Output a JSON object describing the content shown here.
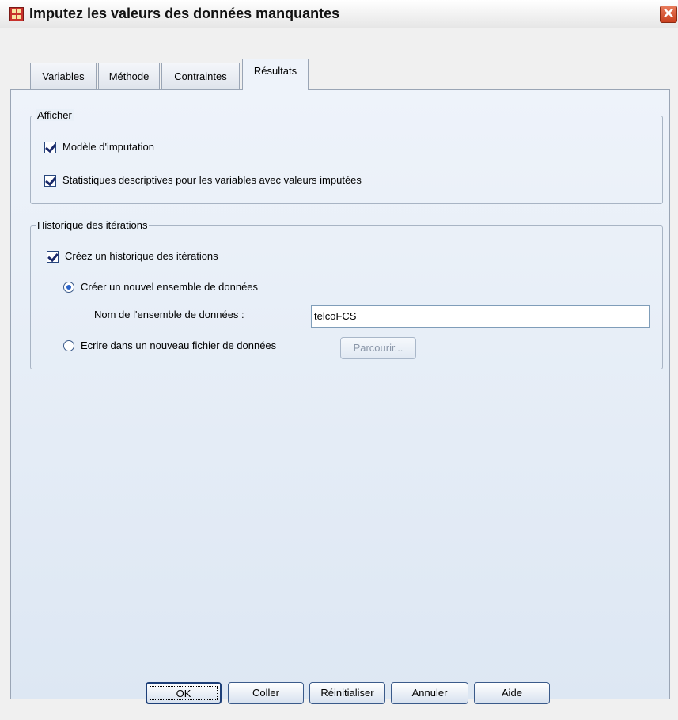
{
  "window": {
    "title": "Imputez les valeurs des données manquantes"
  },
  "tabs": [
    {
      "label": "Variables",
      "active": false
    },
    {
      "label": "Méthode",
      "active": false
    },
    {
      "label": "Contraintes",
      "active": false
    },
    {
      "label": "Résultats",
      "active": true
    }
  ],
  "afficher": {
    "legend": "Afficher",
    "options": [
      {
        "label": "Modèle d'imputation",
        "checked": true
      },
      {
        "label": "Statistiques descriptives pour les variables avec valeurs imputées",
        "checked": true
      }
    ]
  },
  "historique": {
    "legend": "Historique des itérations",
    "create_label": "Créez un historique des itérations",
    "create_checked": true,
    "radio_new_dataset": "Créer un nouvel ensemble de données",
    "radio_new_dataset_selected": true,
    "dataset_name_label": "Nom de l'ensemble de données :",
    "dataset_name_value": "telcoFCS",
    "radio_new_file": "Ecrire dans un nouveau fichier de données",
    "radio_new_file_selected": false,
    "browse_label": "Parcourir..."
  },
  "buttons": {
    "ok": "OK",
    "paste": "Coller",
    "reset": "Réinitialiser",
    "cancel": "Annuler",
    "help": "Aide"
  },
  "icons": {
    "app": "spreadsheet-icon",
    "close": "close-icon"
  },
  "colors": {
    "panel_bg": "#e4ecf6",
    "check_accent": "#1b2a6b",
    "radio_accent": "#2a62c8"
  }
}
